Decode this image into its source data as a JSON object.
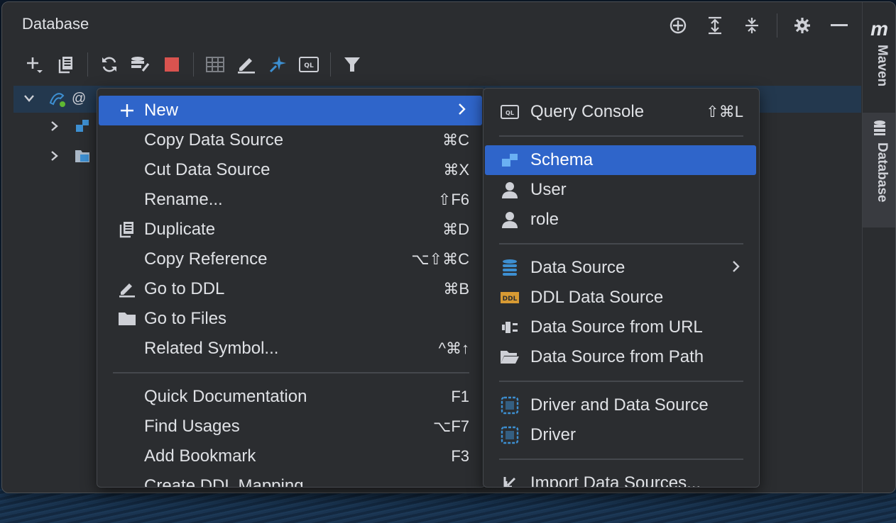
{
  "panel": {
    "title": "Database"
  },
  "tree": {
    "root_suffix": "@"
  },
  "right_strip": {
    "maven_label": "Maven",
    "maven_letter": "m",
    "database_label": "Database"
  },
  "main_menu": {
    "items": [
      {
        "label": "New",
        "shortcut": "",
        "icon": "plus-icon",
        "highlighted": true,
        "submenu": true
      },
      {
        "label": "Copy Data Source",
        "shortcut": "⌘C"
      },
      {
        "label": "Cut Data Source",
        "shortcut": "⌘X"
      },
      {
        "label": "Rename...",
        "shortcut": "⇧F6"
      },
      {
        "label": "Duplicate",
        "shortcut": "⌘D",
        "icon": "duplicate-icon"
      },
      {
        "label": "Copy Reference",
        "shortcut": "⌥⇧⌘C"
      },
      {
        "label": "Go to DDL",
        "shortcut": "⌘B",
        "icon": "pencil-icon"
      },
      {
        "label": "Go to Files",
        "shortcut": "",
        "icon": "folder-icon"
      },
      {
        "label": "Related Symbol...",
        "shortcut": "^⌘↑"
      },
      {
        "label": "Quick Documentation",
        "shortcut": "F1"
      },
      {
        "label": "Find Usages",
        "shortcut": "⌥F7"
      },
      {
        "label": "Add Bookmark",
        "shortcut": "F3"
      },
      {
        "label": "Create DDL Mapping",
        "shortcut": ""
      }
    ]
  },
  "sub_menu": {
    "items": [
      {
        "label": "Query Console",
        "shortcut": "⇧⌘L",
        "icon": "query-console-icon"
      },
      {
        "label": "Schema",
        "icon": "schema-icon",
        "highlighted": true
      },
      {
        "label": "User",
        "icon": "user-icon"
      },
      {
        "label": "role",
        "icon": "role-icon"
      },
      {
        "label": "Data Source",
        "icon": "datasource-icon",
        "submenu": true
      },
      {
        "label": "DDL Data Source",
        "icon": "ddl-icon"
      },
      {
        "label": "Data Source from URL",
        "icon": "url-plug-icon"
      },
      {
        "label": "Data Source from Path",
        "icon": "open-folder-icon"
      },
      {
        "label": "Driver and Data Source",
        "icon": "driver-datasource-icon"
      },
      {
        "label": "Driver",
        "icon": "driver-icon"
      },
      {
        "label": "Import Data Sources...",
        "icon": "import-icon"
      }
    ]
  },
  "colors": {
    "highlight": "#2f65ca",
    "menu_bg": "#2b2d30",
    "selected_row": "#23384e",
    "accent_blue": "#3d8fd1"
  }
}
